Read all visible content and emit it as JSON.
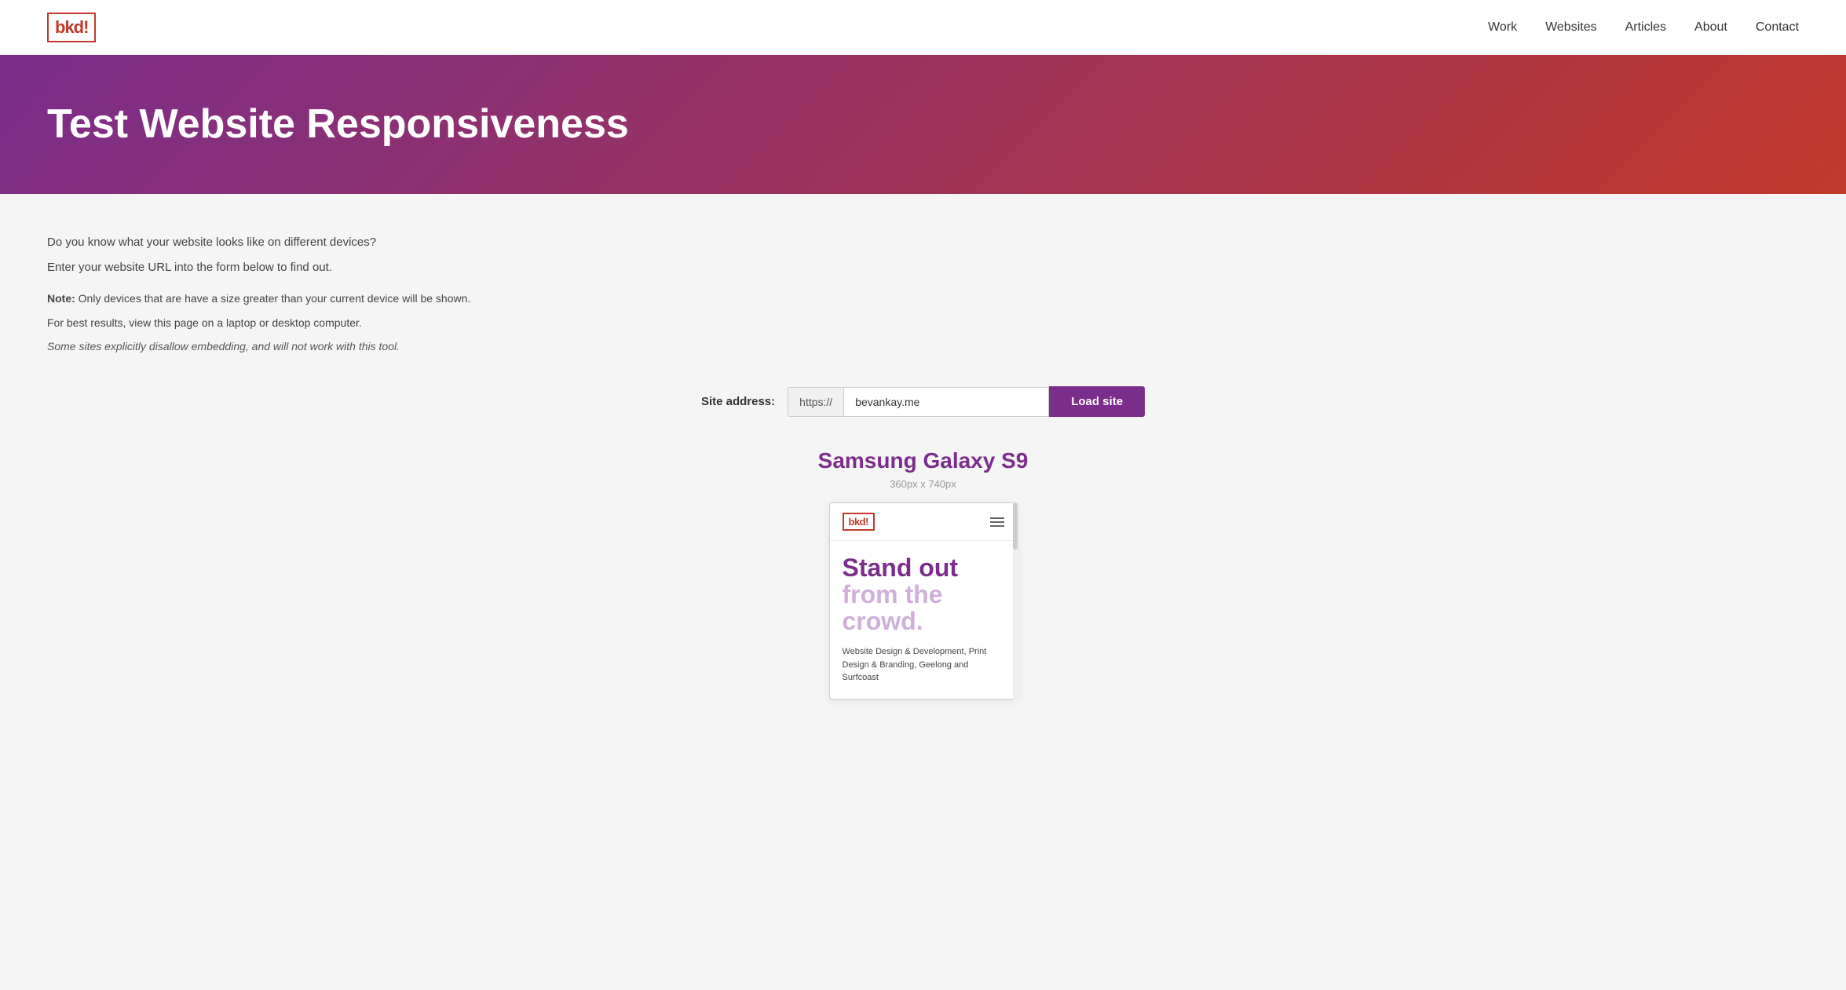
{
  "header": {
    "logo_text": "bkd",
    "logo_exclamation": "!",
    "nav": [
      {
        "label": "Work",
        "href": "#"
      },
      {
        "label": "Websites",
        "href": "#"
      },
      {
        "label": "Articles",
        "href": "#"
      },
      {
        "label": "About",
        "href": "#"
      },
      {
        "label": "Contact",
        "href": "#"
      }
    ]
  },
  "hero": {
    "title": "Test Website Responsiveness"
  },
  "description": {
    "line1": "Do you know what your website looks like on different devices?",
    "line2": "Enter your website URL into the form below to find out.",
    "note_label": "Note:",
    "note_text": "Only devices that are have a size greater than your current device will be shown.",
    "note_line2": "For best results, view this page on a laptop or desktop computer.",
    "note_italic": "Some sites explicitly disallow embedding, and will not work with this tool."
  },
  "form": {
    "label": "Site address:",
    "url_prefix": "https://",
    "url_value": "bevankay.me",
    "url_placeholder": "bevankay.me",
    "submit_label": "Load site"
  },
  "device_preview": {
    "name": "Samsung Galaxy S9",
    "dimensions": "360px x 740px",
    "phone": {
      "logo_text": "bkd",
      "logo_exclamation": "!",
      "headline_bold": "Stand out",
      "headline_light": "from the crowd.",
      "body_text": "Website Design & Development, Print Design & Branding, Geelong and Surfcoast"
    }
  }
}
